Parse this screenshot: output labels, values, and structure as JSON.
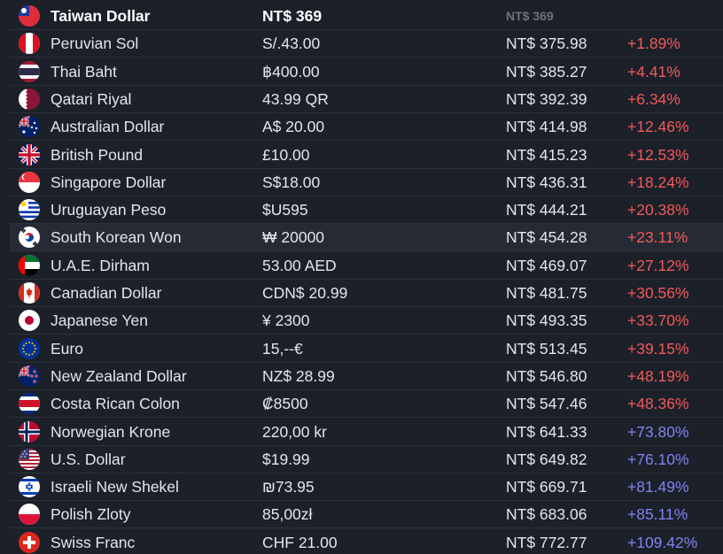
{
  "header": {
    "name": "Taiwan Dollar",
    "local_price": "NT$ 369",
    "converted": "NT$ 369",
    "diff": "",
    "flag": "flag-taiwan-icon"
  },
  "colors": {
    "background": "#1c2029",
    "row_border": "#2c323d",
    "highlight_row": "#252a34",
    "negative": "#ef5a5a",
    "positive": "#8083f0"
  },
  "rows": [
    {
      "name": "Peruvian Sol",
      "local_price": "S/.43.00",
      "converted": "NT$ 375.98",
      "diff": "+1.89%",
      "sign": "neg",
      "flag": "flag-peru-icon"
    },
    {
      "name": "Thai Baht",
      "local_price": "฿400.00",
      "converted": "NT$ 385.27",
      "diff": "+4.41%",
      "sign": "neg",
      "flag": "flag-thailand-icon"
    },
    {
      "name": "Qatari Riyal",
      "local_price": "43.99 QR",
      "converted": "NT$ 392.39",
      "diff": "+6.34%",
      "sign": "neg",
      "flag": "flag-qatar-icon"
    },
    {
      "name": "Australian Dollar",
      "local_price": "A$ 20.00",
      "converted": "NT$ 414.98",
      "diff": "+12.46%",
      "sign": "neg",
      "flag": "flag-australia-icon"
    },
    {
      "name": "British Pound",
      "local_price": "£10.00",
      "converted": "NT$ 415.23",
      "diff": "+12.53%",
      "sign": "neg",
      "flag": "flag-uk-icon"
    },
    {
      "name": "Singapore Dollar",
      "local_price": "S$18.00",
      "converted": "NT$ 436.31",
      "diff": "+18.24%",
      "sign": "neg",
      "flag": "flag-singapore-icon"
    },
    {
      "name": "Uruguayan Peso",
      "local_price": "$U595",
      "converted": "NT$ 444.21",
      "diff": "+20.38%",
      "sign": "neg",
      "flag": "flag-uruguay-icon"
    },
    {
      "name": "South Korean Won",
      "local_price": "₩ 20000",
      "converted": "NT$ 454.28",
      "diff": "+23.11%",
      "sign": "neg",
      "flag": "flag-south-korea-icon",
      "highlight": true
    },
    {
      "name": "U.A.E. Dirham",
      "local_price": "53.00 AED",
      "converted": "NT$ 469.07",
      "diff": "+27.12%",
      "sign": "neg",
      "flag": "flag-uae-icon"
    },
    {
      "name": "Canadian Dollar",
      "local_price": "CDN$ 20.99",
      "converted": "NT$ 481.75",
      "diff": "+30.56%",
      "sign": "neg",
      "flag": "flag-canada-icon"
    },
    {
      "name": "Japanese Yen",
      "local_price": "¥ 2300",
      "converted": "NT$ 493.35",
      "diff": "+33.70%",
      "sign": "neg",
      "flag": "flag-japan-icon"
    },
    {
      "name": "Euro",
      "local_price": "15,--€",
      "converted": "NT$ 513.45",
      "diff": "+39.15%",
      "sign": "neg",
      "flag": "flag-eu-icon"
    },
    {
      "name": "New Zealand Dollar",
      "local_price": "NZ$ 28.99",
      "converted": "NT$ 546.80",
      "diff": "+48.19%",
      "sign": "neg",
      "flag": "flag-new-zealand-icon"
    },
    {
      "name": "Costa Rican Colon",
      "local_price": "₡8500",
      "converted": "NT$ 547.46",
      "diff": "+48.36%",
      "sign": "neg",
      "flag": "flag-costa-rica-icon"
    },
    {
      "name": "Norwegian Krone",
      "local_price": "220,00 kr",
      "converted": "NT$ 641.33",
      "diff": "+73.80%",
      "sign": "pos",
      "flag": "flag-norway-icon"
    },
    {
      "name": "U.S. Dollar",
      "local_price": "$19.99",
      "converted": "NT$ 649.82",
      "diff": "+76.10%",
      "sign": "pos",
      "flag": "flag-usa-icon"
    },
    {
      "name": "Israeli New Shekel",
      "local_price": "₪73.95",
      "converted": "NT$ 669.71",
      "diff": "+81.49%",
      "sign": "pos",
      "flag": "flag-israel-icon"
    },
    {
      "name": "Polish Zloty",
      "local_price": "85,00zł",
      "converted": "NT$ 683.06",
      "diff": "+85.11%",
      "sign": "pos",
      "flag": "flag-poland-icon"
    },
    {
      "name": "Swiss Franc",
      "local_price": "CHF 21.00",
      "converted": "NT$ 772.77",
      "diff": "+109.42%",
      "sign": "pos",
      "flag": "flag-switzerland-icon"
    }
  ]
}
